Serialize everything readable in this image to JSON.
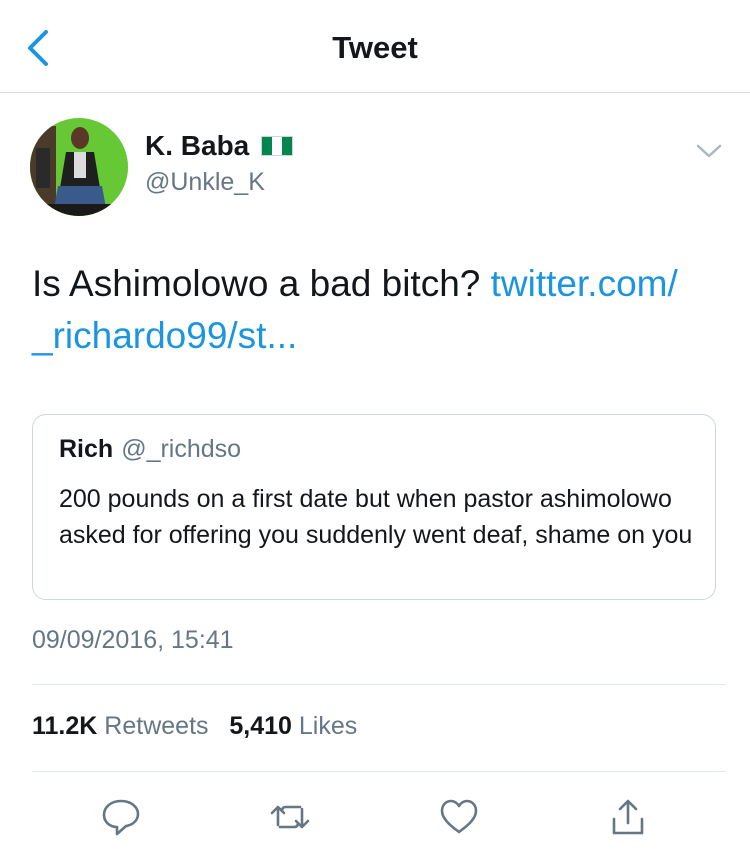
{
  "nav": {
    "title": "Tweet"
  },
  "tweet": {
    "author_name": "K. Baba",
    "author_handle": "@Unkle_K",
    "text": "Is Ashimolowo a bad bitch? ",
    "link_line1": "twitter.com/",
    "link_line2": "_richardo99/st...",
    "timestamp": "09/09/2016, 15:41"
  },
  "quote": {
    "name": "Rich",
    "handle": "@_richdso",
    "text": "200 pounds on a first date but when pastor ashimolowo asked for offering you suddenly went deaf, shame on you"
  },
  "stats": {
    "retweets_count": "11.2K",
    "retweets_label": "Retweets",
    "likes_count": "5,410",
    "likes_label": "Likes"
  },
  "colors": {
    "link": "#1b95e0",
    "muted": "#657786",
    "text": "#14171a",
    "flag_green": "#008751"
  },
  "icons": [
    "back-chevron-icon",
    "nigeria-flag-icon",
    "caret-down-icon",
    "reply-icon",
    "retweet-icon",
    "like-heart-icon",
    "share-icon"
  ]
}
